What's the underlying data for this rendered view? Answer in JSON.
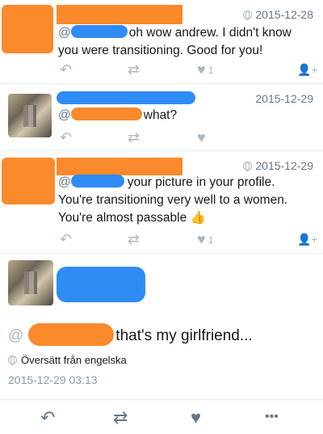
{
  "tweets": [
    {
      "date": "2015-12-28",
      "mention_prefix": "@",
      "text_line1": "oh wow andrew. I didn't know",
      "text_line2": "you were transitioning. Good for you!",
      "like_count": "1"
    },
    {
      "date": "2015-12-29",
      "mention_prefix": "@",
      "text": "what?"
    },
    {
      "date": "2015-12-29",
      "mention_prefix": "@",
      "text_line1": "your picture in your profile.",
      "text_line2": "You're transitioning very well to a women.",
      "text_line3": "You're almost passable",
      "emoji": "👍",
      "like_count": "1"
    }
  ],
  "focused": {
    "mention_prefix": "@",
    "text": "that's my girlfriend...",
    "translate_label": "Översätt från engelska",
    "timestamp": "2015-12-29 03:13"
  },
  "icons": {
    "reply": "↶",
    "retweet": "⇄",
    "like": "♥",
    "follow": "👤+",
    "more": "•••"
  },
  "colors": {
    "redaction_orange": "#fb8a2c",
    "redaction_blue": "#2f8cf5",
    "muted": "#657786"
  }
}
